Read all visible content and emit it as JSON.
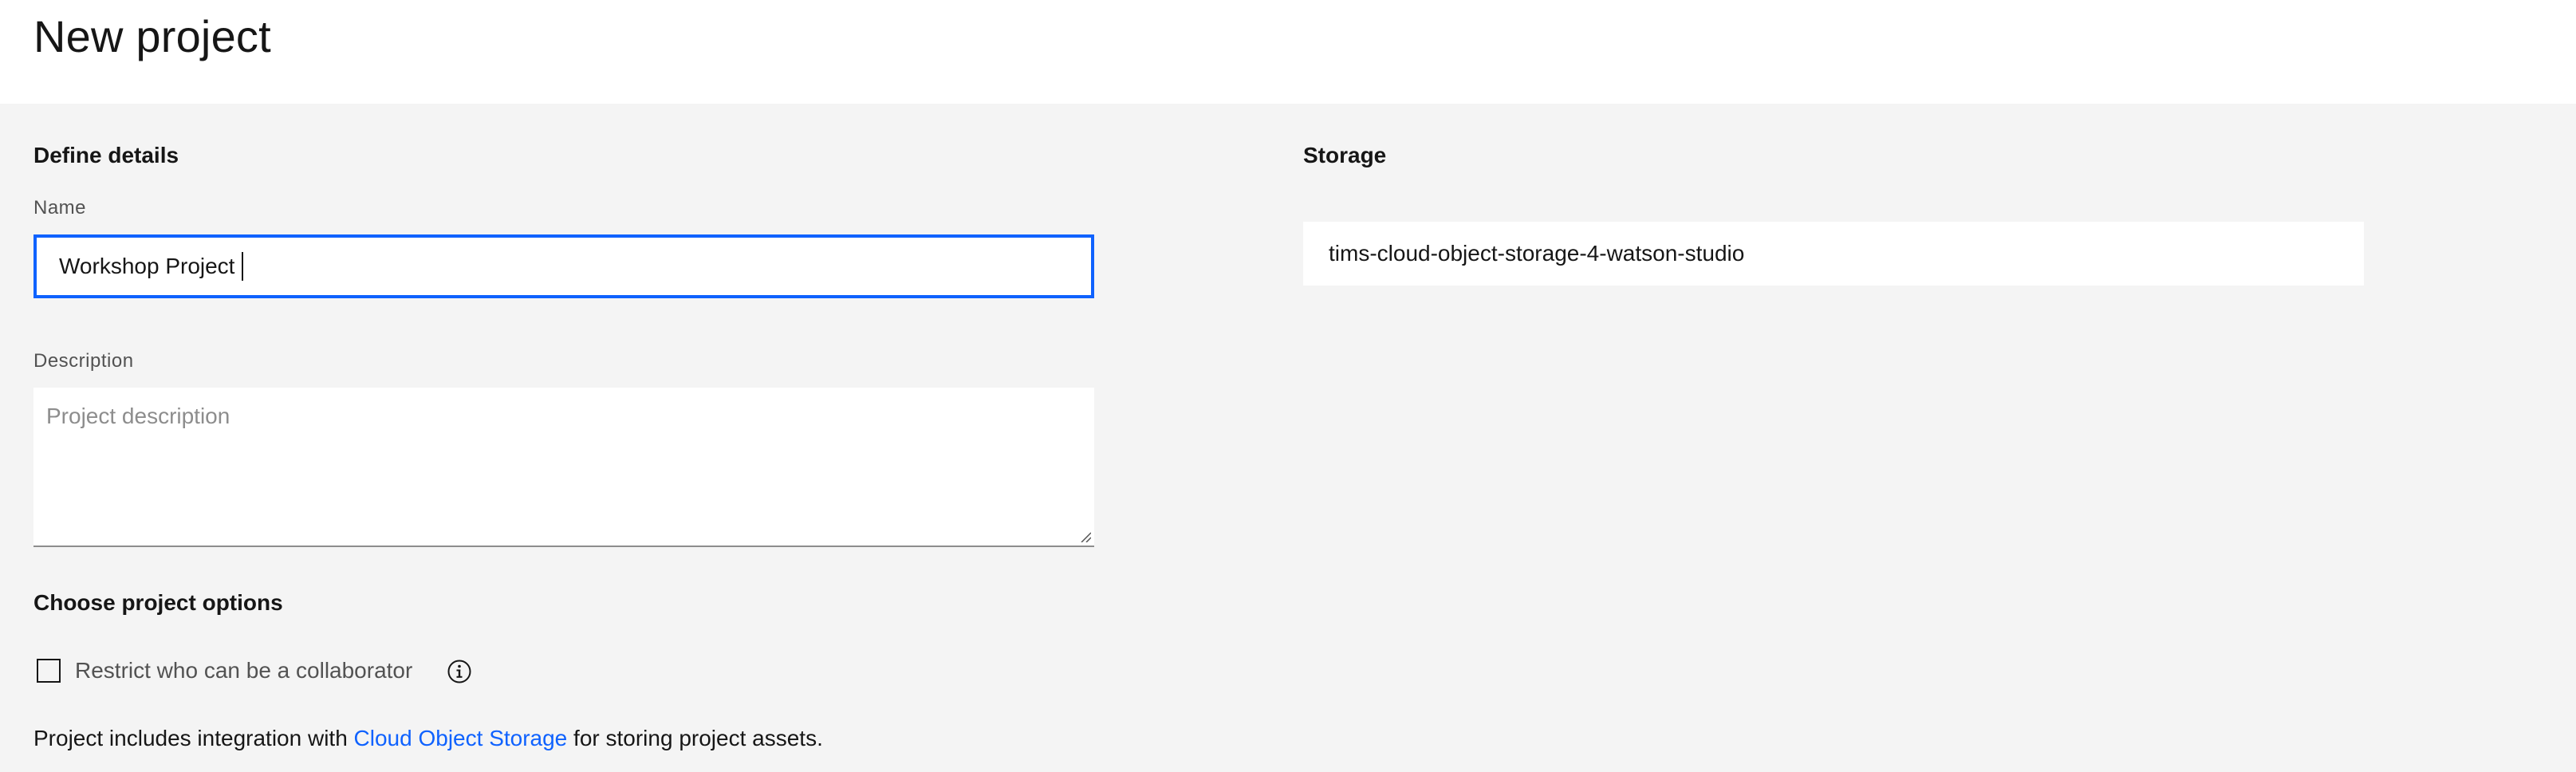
{
  "header": {
    "title": "New project"
  },
  "details": {
    "heading": "Define details",
    "name_label": "Name",
    "name_value": "Workshop Project",
    "description_label": "Description",
    "description_value": "",
    "description_placeholder": "Project description"
  },
  "options": {
    "heading": "Choose project options",
    "restrict_label": "Restrict who can be a collaborator",
    "restrict_checked": false,
    "info_icon": "info-icon"
  },
  "integration": {
    "prefix": "Project includes integration with ",
    "link_text": "Cloud Object Storage",
    "suffix": " for storing project assets."
  },
  "storage": {
    "heading": "Storage",
    "instance": "tims-cloud-object-storage-4-watson-studio"
  },
  "colors": {
    "accent": "#0f62fe",
    "background": "#f4f4f4",
    "text": "#161616",
    "secondary_text": "#525252"
  }
}
